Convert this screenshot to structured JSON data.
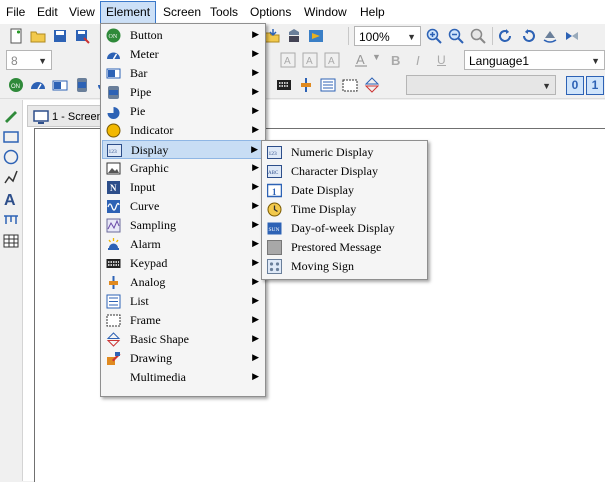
{
  "menubar": [
    "File",
    "Edit",
    "View",
    "Element",
    "Screen",
    "Tools",
    "Options",
    "Window",
    "Help"
  ],
  "toolbar": {
    "zoom_value": "100%",
    "font_size_value": "8",
    "language_value": "Language1",
    "num_0": "0",
    "num_1": "1"
  },
  "document_tab": "1 - Screen",
  "element_menu": [
    {
      "label": "Button",
      "icon": "on-button-icon"
    },
    {
      "label": "Meter",
      "icon": "meter-icon"
    },
    {
      "label": "Bar",
      "icon": "bar-icon"
    },
    {
      "label": "Pipe",
      "icon": "pipe-icon"
    },
    {
      "label": "Pie",
      "icon": "pie-icon"
    },
    {
      "label": "Indicator",
      "icon": "indicator-icon"
    },
    {
      "label": "Display",
      "icon": "display-123-icon"
    },
    {
      "label": "Graphic",
      "icon": "graphic-icon"
    },
    {
      "label": "Input",
      "icon": "input-icon"
    },
    {
      "label": "Curve",
      "icon": "curve-icon"
    },
    {
      "label": "Sampling",
      "icon": "sampling-icon"
    },
    {
      "label": "Alarm",
      "icon": "alarm-icon"
    },
    {
      "label": "Keypad",
      "icon": "keypad-icon"
    },
    {
      "label": "Analog",
      "icon": "analog-icon"
    },
    {
      "label": "List",
      "icon": "list-icon"
    },
    {
      "label": "Frame",
      "icon": "frame-icon"
    },
    {
      "label": "Basic Shape",
      "icon": "basic-shape-icon"
    },
    {
      "label": "Drawing",
      "icon": "drawing-icon"
    },
    {
      "label": "Multimedia",
      "icon": ""
    }
  ],
  "display_submenu": [
    {
      "label": "Numeric Display",
      "icon": "numeric-display-icon"
    },
    {
      "label": "Character Display",
      "icon": "character-display-icon"
    },
    {
      "label": "Date Display",
      "icon": "date-display-icon"
    },
    {
      "label": "Time Display",
      "icon": "time-display-icon"
    },
    {
      "label": "Day-of-week Display",
      "icon": "day-of-week-display-icon"
    },
    {
      "label": "Prestored Message",
      "icon": "prestored-message-icon"
    },
    {
      "label": "Moving Sign",
      "icon": "moving-sign-icon"
    }
  ],
  "colors": {
    "highlight": "#c8ddf4",
    "menubar_active": "#cce0f7"
  }
}
